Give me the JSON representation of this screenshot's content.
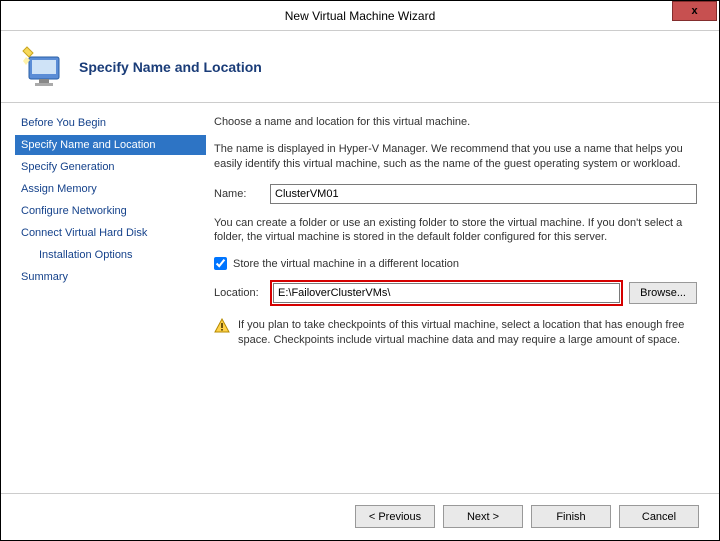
{
  "window": {
    "title": "New Virtual Machine Wizard",
    "close_symbol": "x"
  },
  "header": {
    "title": "Specify Name and Location"
  },
  "sidebar": {
    "items": [
      {
        "label": "Before You Begin"
      },
      {
        "label": "Specify Name and Location"
      },
      {
        "label": "Specify Generation"
      },
      {
        "label": "Assign Memory"
      },
      {
        "label": "Configure Networking"
      },
      {
        "label": "Connect Virtual Hard Disk"
      },
      {
        "label": "Installation Options"
      },
      {
        "label": "Summary"
      }
    ]
  },
  "content": {
    "intro": "Choose a name and location for this virtual machine.",
    "name_help": "The name is displayed in Hyper-V Manager. We recommend that you use a name that helps you easily identify this virtual machine, such as the name of the guest operating system or workload.",
    "name_label": "Name:",
    "name_value": "ClusterVM01",
    "folder_help": "You can create a folder or use an existing folder to store the virtual machine. If you don't select a folder, the virtual machine is stored in the default folder configured for this server.",
    "store_checkbox_label": "Store the virtual machine in a different location",
    "store_checked": true,
    "location_label": "Location:",
    "location_value": "E:\\FailoverClusterVMs\\",
    "browse_label": "Browse...",
    "warning_text": "If you plan to take checkpoints of this virtual machine, select a location that has enough free space. Checkpoints include virtual machine data and may require a large amount of space."
  },
  "footer": {
    "previous": "< Previous",
    "next": "Next >",
    "finish": "Finish",
    "cancel": "Cancel"
  }
}
